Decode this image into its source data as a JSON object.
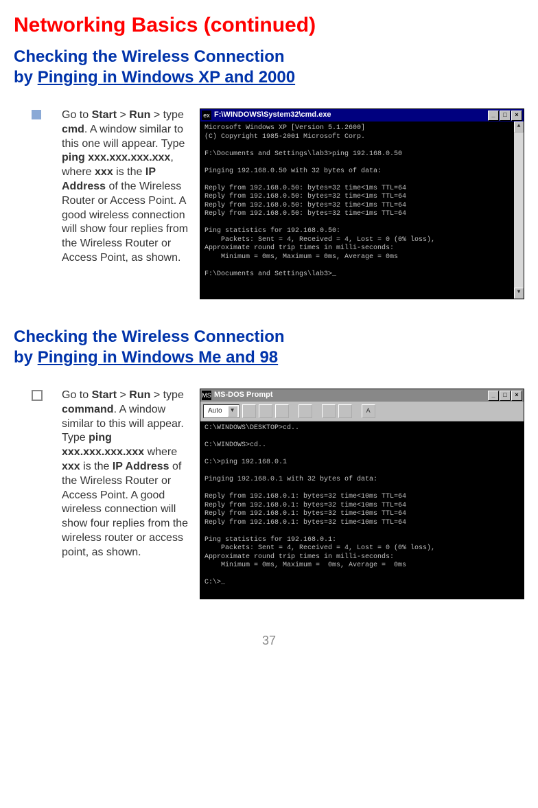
{
  "page_title": "Networking Basics (continued)",
  "page_number": "37",
  "section1": {
    "heading_line1": "Checking the Wireless Connection",
    "heading_prefix2": "by ",
    "heading_underline2": "Pinging in Windows XP and 2000",
    "instruction_html": "Go to <b>Start</b> > <b>Run</b> > type <b>cmd</b>.  A window similar to this one will appear.  Type <b>ping xxx.xxx.xxx.xxx</b>, where <b>xxx</b> is the <b>IP Address</b> of the Wireless Router or Access Point.  A good wireless connection will show four replies from the Wireless Router or Access Point, as shown.",
    "window": {
      "title_prefix": "ex",
      "title": "F:\\WINDOWS\\System32\\cmd.exe",
      "btn_min": "_",
      "btn_max": "□",
      "btn_close": "×",
      "scroll_up": "▲",
      "scroll_down": "▼",
      "console": "Microsoft Windows XP [Version 5.1.2600]\n(C) Copyright 1985-2001 Microsoft Corp.\n\nF:\\Documents and Settings\\lab3>ping 192.168.0.50\n\nPinging 192.168.0.50 with 32 bytes of data:\n\nReply from 192.168.0.50: bytes=32 time<1ms TTL=64\nReply from 192.168.0.50: bytes=32 time<1ms TTL=64\nReply from 192.168.0.50: bytes=32 time<1ms TTL=64\nReply from 192.168.0.50: bytes=32 time<1ms TTL=64\n\nPing statistics for 192.168.0.50:\n    Packets: Sent = 4, Received = 4, Lost = 0 (0% loss),\nApproximate round trip times in milli-seconds:\n    Minimum = 0ms, Maximum = 0ms, Average = 0ms\n\nF:\\Documents and Settings\\lab3>_"
    }
  },
  "section2": {
    "heading_line1": "Checking the Wireless Connection",
    "heading_prefix2": "by ",
    "heading_underline2": "Pinging in Windows Me and 98",
    "instruction_html": "Go to <b>Start</b> > <b>Run</b> > type <b>command</b>.  A window similar to this will appear.  Type <b>ping xxx.xxx.xxx.xxx</b> where <b>xxx</b> is the <b>IP Address</b> of the Wireless Router or Access Point.  A good wireless connection will show four replies from the wireless router or access point, as shown.",
    "window": {
      "icon": "MS",
      "title": "MS-DOS Prompt",
      "btn_min": "_",
      "btn_max": "□",
      "btn_close": "×",
      "dropdown": "Auto",
      "dropdown_arrow": "▼",
      "tool_a": "A",
      "console": "C:\\WINDOWS\\DESKTOP>cd..\n\nC:\\WINDOWS>cd..\n\nC:\\>ping 192.168.0.1\n\nPinging 192.168.0.1 with 32 bytes of data:\n\nReply from 192.168.0.1: bytes=32 time<10ms TTL=64\nReply from 192.168.0.1: bytes=32 time<10ms TTL=64\nReply from 192.168.0.1: bytes=32 time<10ms TTL=64\nReply from 192.168.0.1: bytes=32 time<10ms TTL=64\n\nPing statistics for 192.168.0.1:\n    Packets: Sent = 4, Received = 4, Lost = 0 (0% loss),\nApproximate round trip times in milli-seconds:\n    Minimum = 0ms, Maximum =  0ms, Average =  0ms\n\nC:\\>_"
    }
  }
}
